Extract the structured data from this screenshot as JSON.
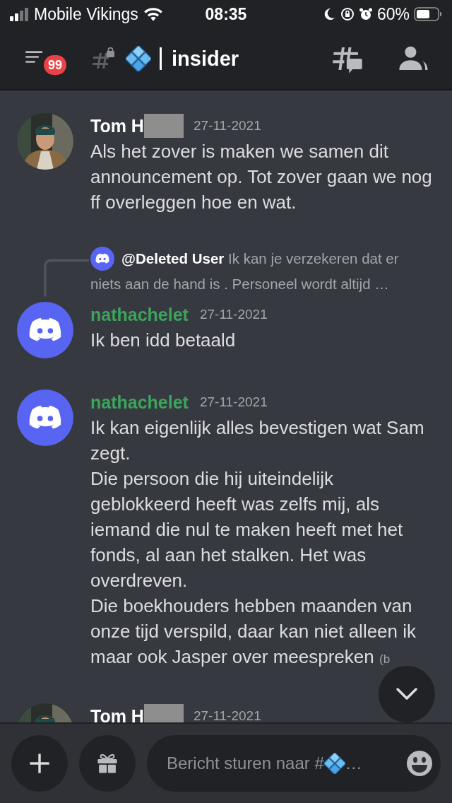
{
  "status_bar": {
    "carrier": "Mobile Vikings",
    "time": "08:35",
    "battery": "60%"
  },
  "header": {
    "badge": "99",
    "channel": "insider"
  },
  "messages": [
    {
      "author": "Tom H",
      "redacted": true,
      "color": "#ffffff",
      "date": "27-11-2021",
      "text": "Als het zover is maken we samen dit announcement op. Tot zover gaan we nog ff overleggen hoe en wat."
    },
    {
      "kind": "default",
      "reply": {
        "author": "@Deleted User",
        "text": "Ik kan je verzekeren dat er niets aan de hand is .  Personeel wordt altijd …"
      },
      "author": "nathachelet",
      "redacted": false,
      "color": "#3ba55c",
      "date": "27-11-2021",
      "text": "Ik ben idd betaald"
    },
    {
      "kind": "default",
      "author": "nathachelet",
      "redacted": false,
      "color": "#3ba55c",
      "date": "27-11-2021",
      "text": "Ik kan eigenlijk alles bevestigen wat Sam zegt.\nDie persoon die hij uiteindelijk geblokkeerd heeft was zelfs mij, als iemand die nul te maken heeft met het fonds, al aan het stalken. Het was overdreven.\nDie boekhouders hebben maanden van onze tijd verspild, daar kan niet alleen ik maar ook Jasper over meespreken",
      "edited": "(b"
    },
    {
      "author": "Tom H",
      "redacted": true,
      "color": "#ffffff",
      "date": "27-11-2021"
    }
  ],
  "composer": {
    "placeholder": "Bericht sturen naar #",
    "placeholder_end": "…"
  }
}
